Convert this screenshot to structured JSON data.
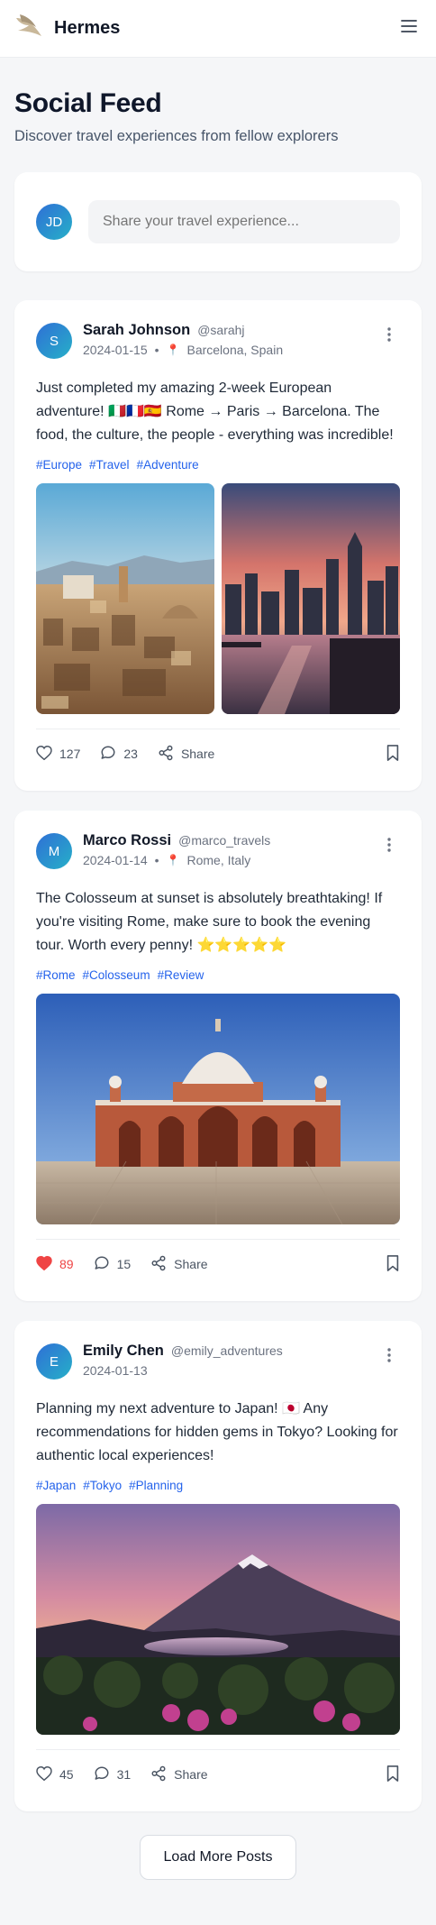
{
  "app": {
    "name": "Hermes"
  },
  "page": {
    "title": "Social Feed",
    "subtitle": "Discover travel experiences from fellow explorers"
  },
  "composer": {
    "avatar_initials": "JD",
    "placeholder": "Share your travel experience..."
  },
  "posts": [
    {
      "avatar_initial": "S",
      "name": "Sarah Johnson",
      "handle": "@sarahj",
      "date": "2024-01-15",
      "location": "Barcelona, Spain",
      "text": "Just completed my amazing 2-week European adventure! 🇮🇹🇫🇷🇪🇸 Rome → Paris → Barcelona. The food, the culture, the people - everything was incredible!",
      "tags": [
        "#Europe",
        "#Travel",
        "#Adventure"
      ],
      "images": [
        "rome-cityscape",
        "city-skyline-sunset"
      ],
      "likes": "127",
      "liked": false,
      "comments": "23",
      "share_label": "Share"
    },
    {
      "avatar_initial": "M",
      "name": "Marco Rossi",
      "handle": "@marco_travels",
      "date": "2024-01-14",
      "location": "Rome, Italy",
      "text": "The Colosseum at sunset is absolutely breathtaking! If you're visiting Rome, make sure to book the evening tour. Worth every penny! ⭐⭐⭐⭐⭐",
      "tags": [
        "#Rome",
        "#Colosseum",
        "#Review"
      ],
      "images": [
        "domed-monument"
      ],
      "likes": "89",
      "liked": true,
      "comments": "15",
      "share_label": "Share"
    },
    {
      "avatar_initial": "E",
      "name": "Emily Chen",
      "handle": "@emily_adventures",
      "date": "2024-01-13",
      "location": "",
      "text": "Planning my next adventure to Japan! 🇯🇵 Any recommendations for hidden gems in Tokyo? Looking for authentic local experiences!",
      "tags": [
        "#Japan",
        "#Tokyo",
        "#Planning"
      ],
      "images": [
        "mount-fuji-sunset"
      ],
      "likes": "45",
      "liked": false,
      "comments": "31",
      "share_label": "Share"
    }
  ],
  "load_more_label": "Load More Posts",
  "colors": {
    "accent": "#2563eb",
    "like": "#ef4444",
    "avatar_from": "#2f6fd6",
    "avatar_to": "#26b0c8"
  }
}
